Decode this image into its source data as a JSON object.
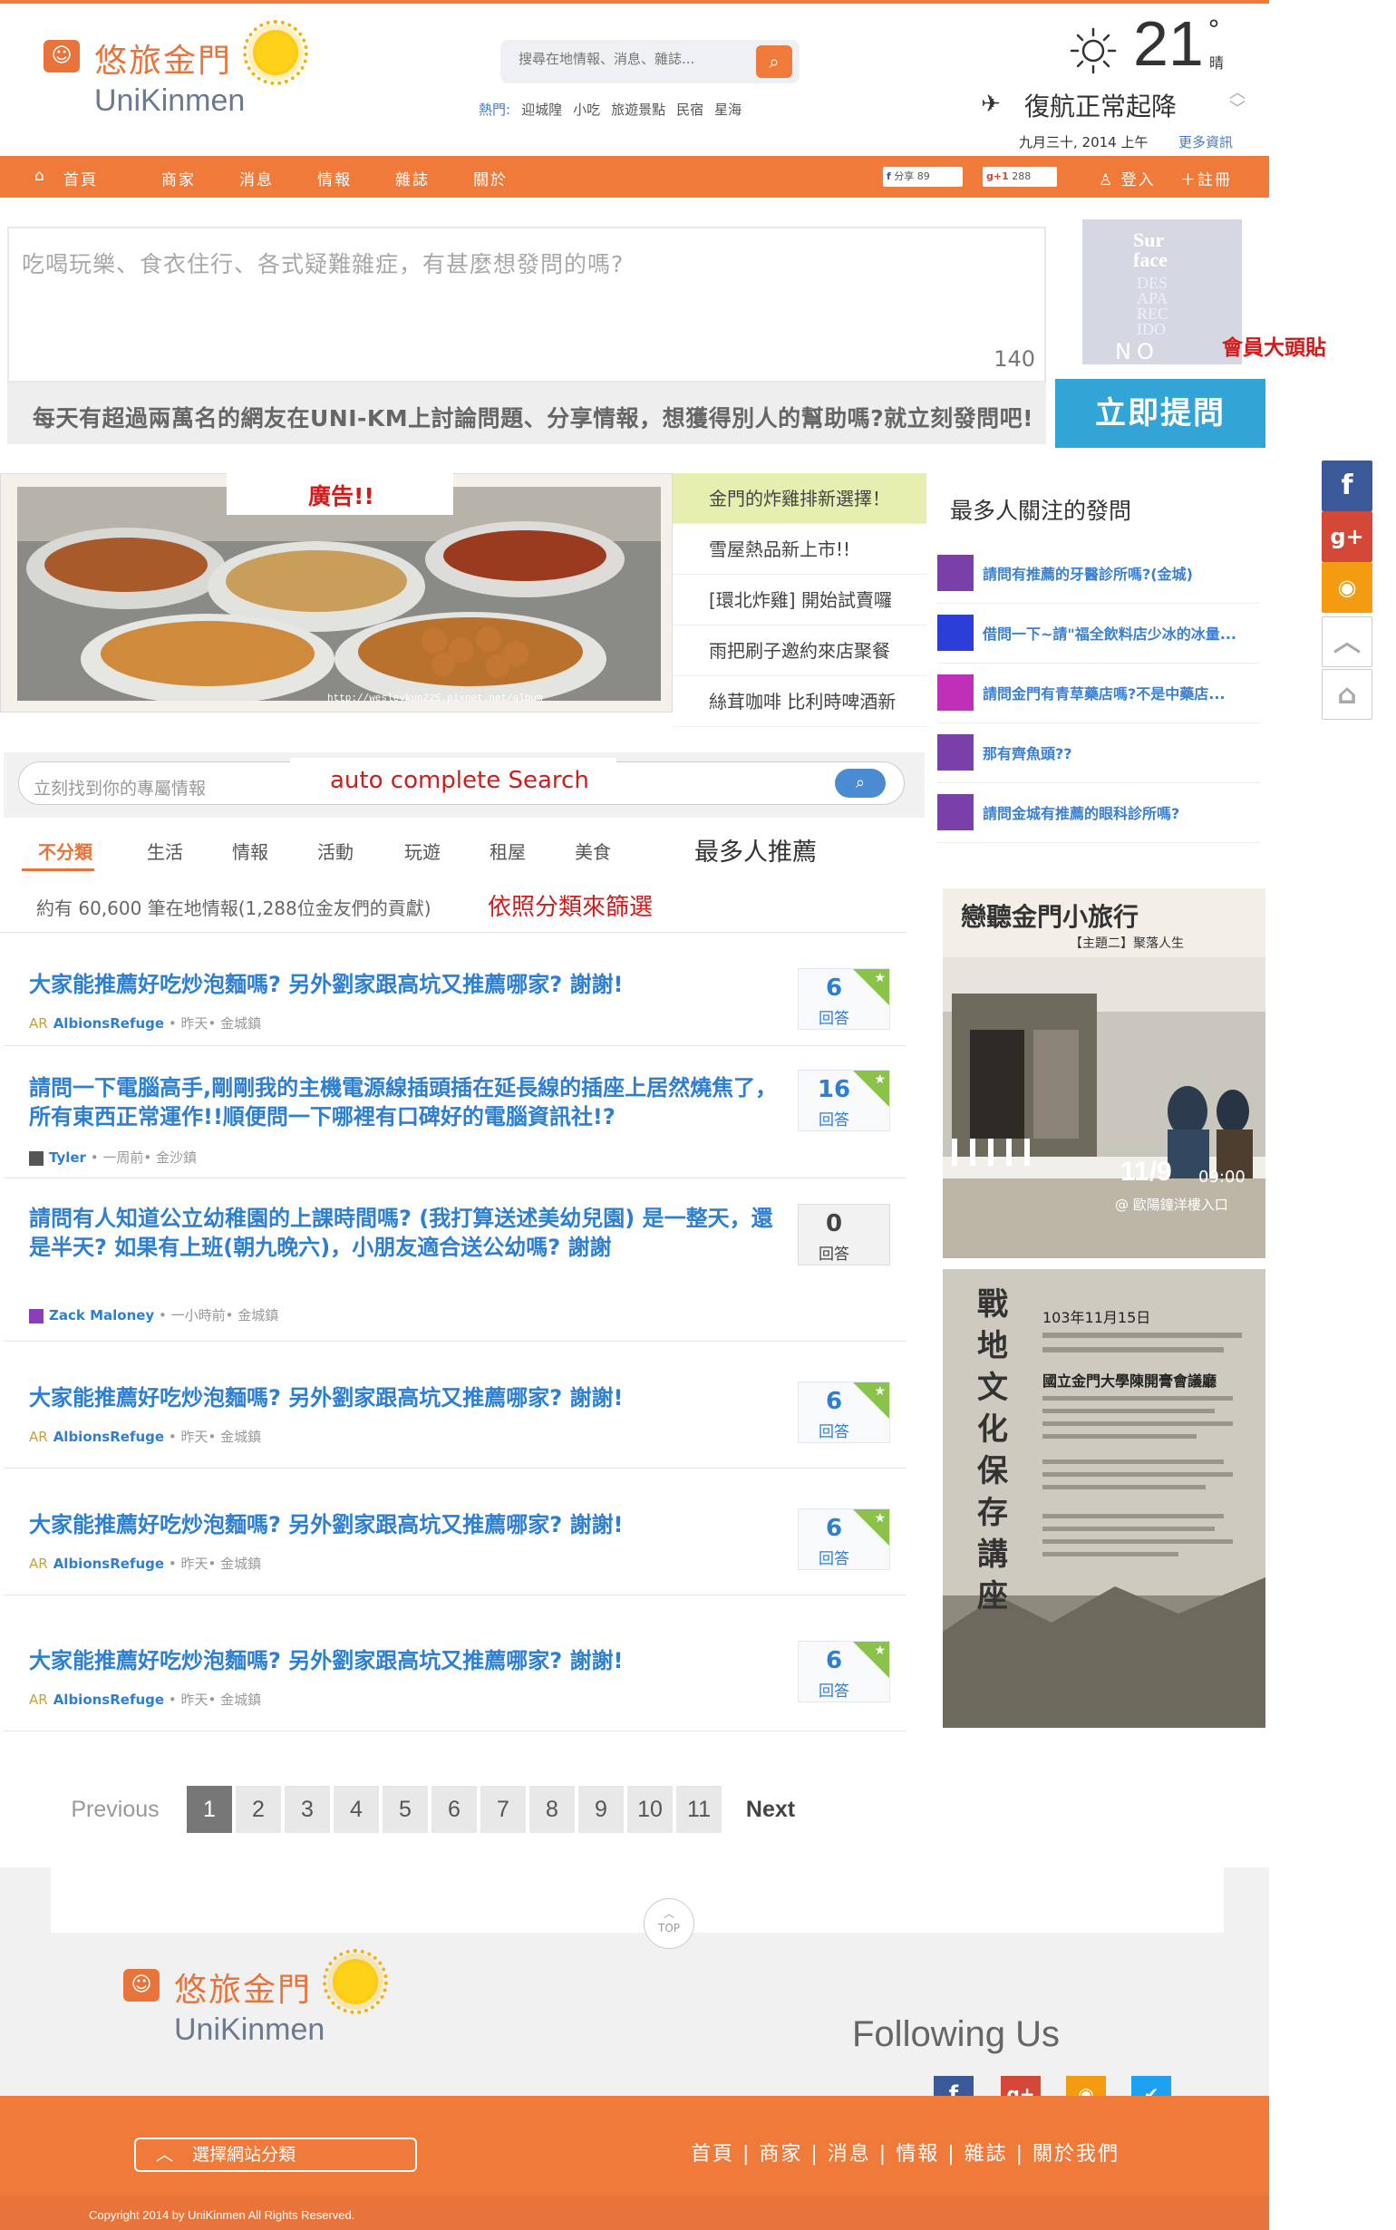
{
  "brand": {
    "name_cn": "悠旅金門",
    "name_en": "UniKinmen"
  },
  "search": {
    "placeholder": "搜尋在地情報、消息、雜誌..."
  },
  "hot": {
    "label": "熱門:",
    "tags": [
      "迎城隍",
      "小吃",
      "旅遊景點",
      "民宿",
      "星海"
    ]
  },
  "weather": {
    "temp": "21",
    "deg": "°",
    "sky": "晴",
    "flight_status": "復航正常起降",
    "date": "九月三十, 2014  上午",
    "more": "更多資訊"
  },
  "nav": {
    "items": [
      "首頁",
      "商家",
      "消息",
      "情報",
      "雜誌",
      "關於"
    ],
    "fb_share": "分享",
    "fb_count": "89",
    "gplus_count": "288",
    "login": "登入",
    "register": "註冊"
  },
  "ask": {
    "placeholder": "吃喝玩樂、食衣住行、各式疑難雜症，有甚麼想發問的嗎?",
    "count": "140",
    "hint": "每天有超過兩萬名的網友在UNI-KM上討論問題、分享情報，想獲得別人的幫助嗎?就立刻發問吧!",
    "button": "立即提問",
    "avatar_label": "會員大頭貼",
    "avatar_text": [
      "Sur",
      "face",
      "DES",
      "APA",
      "REC",
      "IDO",
      "NO"
    ]
  },
  "ad": {
    "label": "廣告!!",
    "url": "http://wesleykuo225.pixnet.net/album",
    "list": [
      "金門的炸雞排新選擇！",
      "雪屋熱品新上市!!",
      "[環北炸雞] 開始試賣囉",
      "雨把刷子邀約來店聚餐",
      "絲茸咖啡 比利時啤酒新"
    ]
  },
  "popular": {
    "title": "最多人關注的發問",
    "items": [
      {
        "text": "請問有推薦的牙醫診所嗎?(金城)",
        "color": "#7a3fa8"
      },
      {
        "text": "借問一下~請\"福全飲料店少冰的冰量...",
        "color": "#2b3fd8"
      },
      {
        "text": "請問金門有青草藥店嗎?不是中藥店...",
        "color": "#c02fb8"
      },
      {
        "text": "那有齊魚頭??",
        "color": "#7a3fa8"
      },
      {
        "text": "請問金城有推薦的眼科診所嗎?",
        "color": "#7a3fa8"
      }
    ]
  },
  "filter": {
    "placeholder": "立刻找到你的專屬情報",
    "autocomplete_label": "auto complete Search",
    "categories": [
      "不分類",
      "生活",
      "情報",
      "活動",
      "玩遊",
      "租屋",
      "美食"
    ],
    "most_recommended": "最多人推薦",
    "count_text": "約有 60,600 筆在地情報(1,288位金友們的貢獻)",
    "note": "依照分類來篩選"
  },
  "questions": [
    {
      "title": "大家能推薦好吃炒泡麵嗎?  另外劉家跟高坑又推薦哪家?  謝謝!",
      "user": "AlbionsRefuge",
      "meta": " • 昨天• 金城鎮",
      "count": "6",
      "label": "回答",
      "av": "AR"
    },
    {
      "title": "請問一下電腦高手,剛剛我的主機電源線插頭插在延長線的插座上居然燒焦了，所有東西正常運作!!順便問一下哪裡有口碑好的電腦資訊社!?",
      "user": "Tyler",
      "meta": " • 一周前• 金沙鎮",
      "count": "16",
      "label": "回答",
      "av": ""
    },
    {
      "title": "請問有人知道公立幼稚園的上課時間嗎?  (我打算送述美幼兒園) 是一整天，還是半天?  如果有上班(朝九晚六)，小朋友適合送公幼嗎?  謝謝",
      "user": "Zack Maloney",
      "meta": " • 一小時前• 金城鎮",
      "count": "0",
      "label": "回答",
      "av": ""
    },
    {
      "title": "大家能推薦好吃炒泡麵嗎?  另外劉家跟高坑又推薦哪家?  謝謝!",
      "user": "AlbionsRefuge",
      "meta": " • 昨天• 金城鎮",
      "count": "6",
      "label": "回答",
      "av": "AR"
    },
    {
      "title": "大家能推薦好吃炒泡麵嗎?  另外劉家跟高坑又推薦哪家?  謝謝!",
      "user": "AlbionsRefuge",
      "meta": " • 昨天• 金城鎮",
      "count": "6",
      "label": "回答",
      "av": "AR"
    },
    {
      "title": "大家能推薦好吃炒泡麵嗎?  另外劉家跟高坑又推薦哪家?  謝謝!",
      "user": "AlbionsRefuge",
      "meta": " • 昨天• 金城鎮",
      "count": "6",
      "label": "回答",
      "av": "AR"
    }
  ],
  "poster1": {
    "title": "戀聽金門小旅行",
    "sub": "【主題二】聚落人生",
    "date": "11/9",
    "time": "09:00",
    "place": "@ 歐陽鐘洋樓入口"
  },
  "poster2": {
    "title": "戰地文化保存講座",
    "date": "103年11月15日",
    "venue": "國立金門大學陳開膏會議廳"
  },
  "pager": {
    "prev": "Previous",
    "pages": [
      "1",
      "2",
      "3",
      "4",
      "5",
      "6",
      "7",
      "8",
      "9",
      "10",
      "11"
    ],
    "next": "Next"
  },
  "footer": {
    "top": "TOP",
    "following": "Following Us",
    "select_category": "選擇網站分類",
    "nav": "首頁  |  商家  |  消息  |  情報  |  雜誌  |  關於我們",
    "copyright": "Copyright 2014 by UniKinmen All Rights Reserved."
  }
}
